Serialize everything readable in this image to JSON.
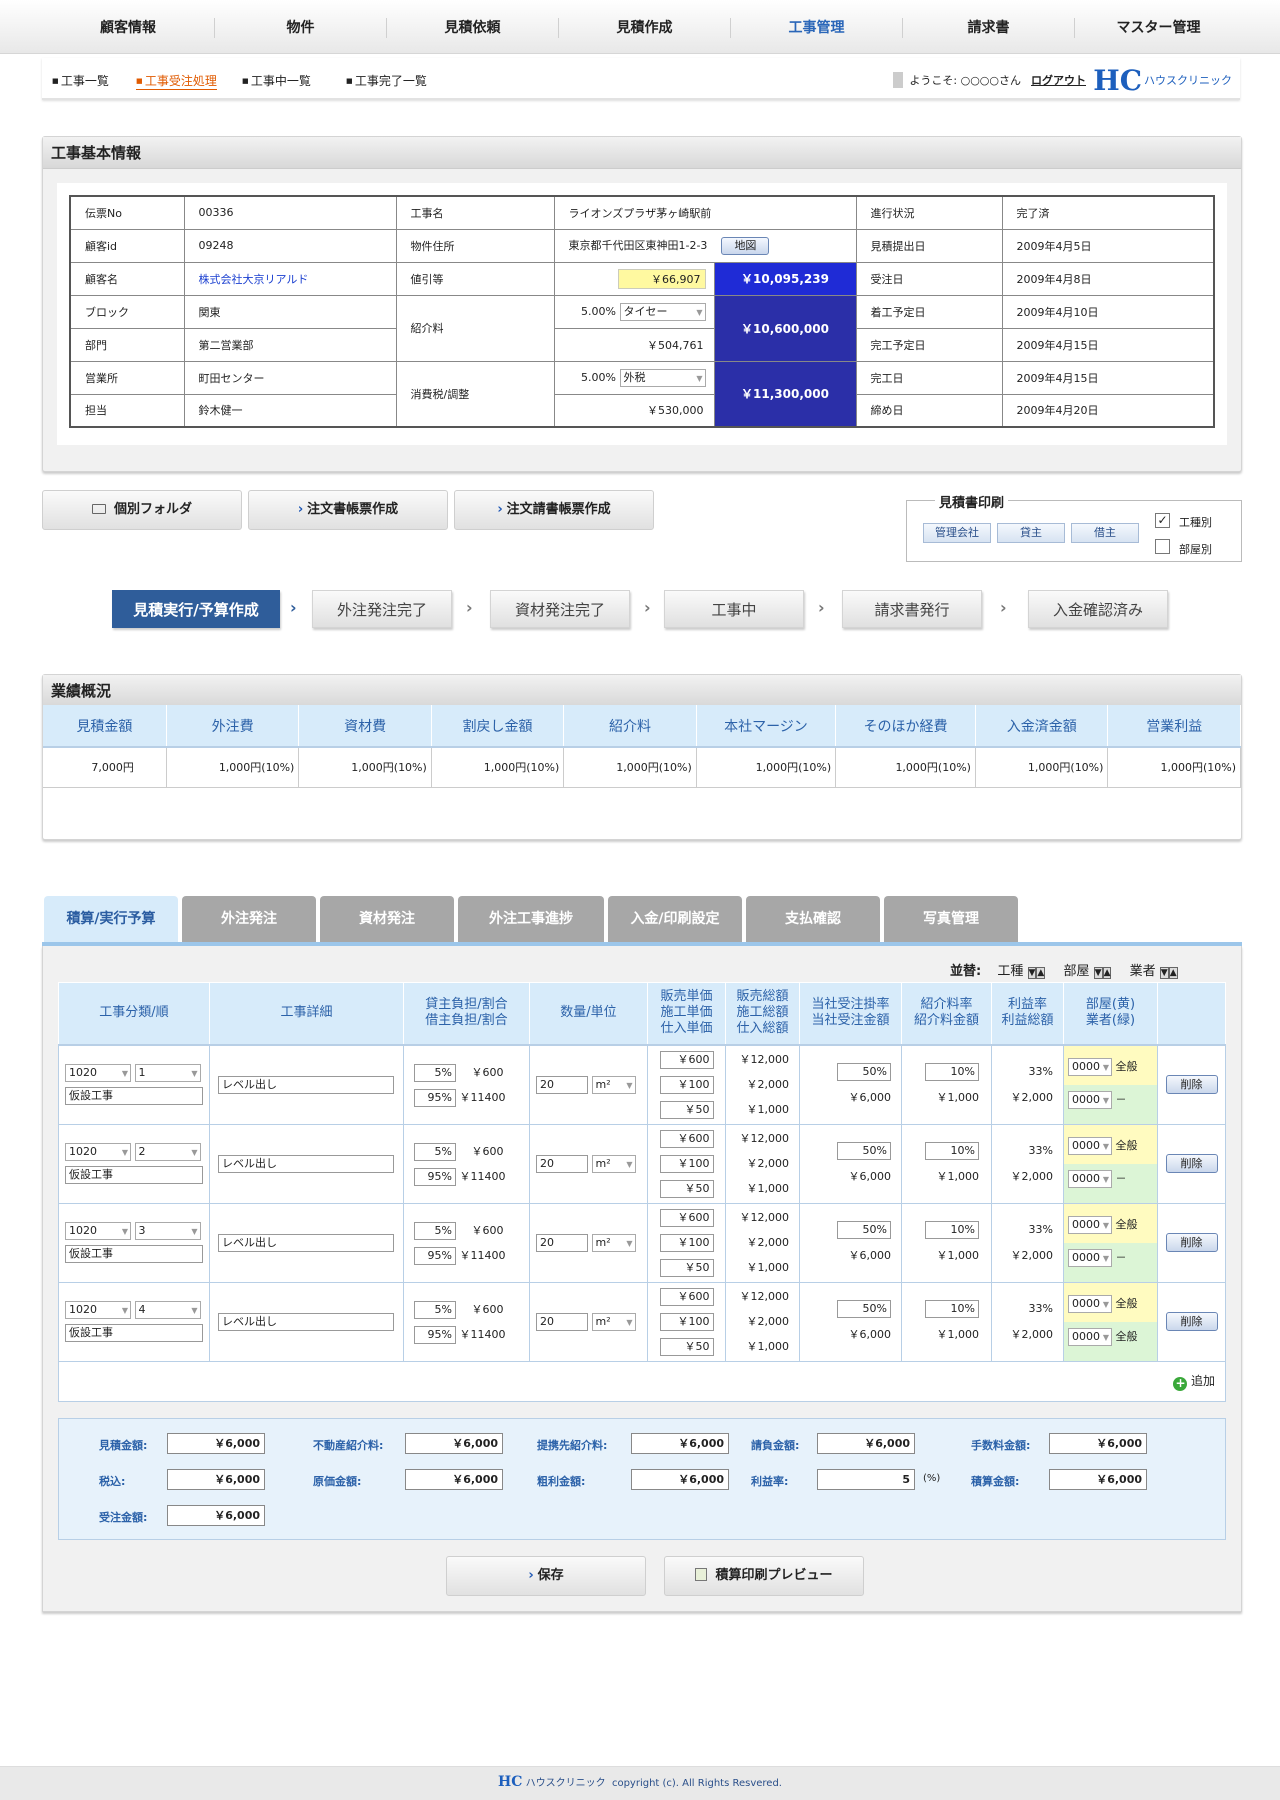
{
  "nav": [
    "顧客情報",
    "物件",
    "見積依頼",
    "見積作成",
    "工事管理",
    "請求書",
    "マスター管理"
  ],
  "subnav": [
    "工事一覧",
    "工事受注処理",
    "工事中一覧",
    "工事完了一覧"
  ],
  "header": {
    "welcome": "ようこそ: ○○○○さん",
    "logout": "ログアウト",
    "logo_mark": "HC",
    "logo_text": "ハウスクリニック"
  },
  "basic": {
    "title": "工事基本情報",
    "denpyo_label": "伝票No",
    "denpyo": "00336",
    "kokyaku_id_label": "顧客id",
    "kokyaku_id": "09248",
    "kokyaku_name_label": "顧客名",
    "kokyaku_name": "株式会社大京リアルド",
    "block_label": "ブロック",
    "block": "関東",
    "bumon_label": "部門",
    "bumon": "第二営業部",
    "eigyosho_label": "営業所",
    "eigyosho": "町田センター",
    "tanto_label": "担当",
    "tanto": "鈴木健一",
    "koji_label": "工事名",
    "koji": "ライオンズプラザ茅ヶ崎駅前",
    "address_label": "物件住所",
    "address": "東京都千代田区東神田1-2-3",
    "map_button": "地図",
    "nebiki_label": "値引等",
    "nebiki": "￥66,907",
    "total1": "￥10,095,239",
    "shokai_label": "紹介料",
    "shokai_rate": "5.00%",
    "shokai_sel": "タイセー",
    "shokai_amount": "￥504,761",
    "total2": "￥10,600,000",
    "tax_label": "消費税/調整",
    "tax_rate": "5.00%",
    "tax_sel": "外税",
    "tax_amount": "￥530,000",
    "total3": "￥11,300,000",
    "status_label": "進行状況",
    "status": "完了済",
    "mitsumori_label": "見積提出日",
    "mitsumori": "2009年4月5日",
    "juchu_label": "受注日",
    "juchu": "2009年4月8日",
    "chakko_label": "着工予定日",
    "chakko": "2009年4月10日",
    "kanryo_yotei_label": "完工予定日",
    "kanryo_yotei": "2009年4月15日",
    "kanko_label": "完工日",
    "kanko": "2009年4月15日",
    "shime_label": "締め日",
    "shime": "2009年4月20日"
  },
  "actions": {
    "folder": "個別フォルダ",
    "order_doc": "注文書帳票作成",
    "order_accept_doc": "注文請書帳票作成"
  },
  "print": {
    "title": "見積書印刷",
    "btn1": "管理会社",
    "btn2": "貸主",
    "btn3": "借主",
    "chk1": "工種別",
    "chk2": "部屋別",
    "chk1_checked": "✓"
  },
  "workflow": [
    "見積実行/予算作成",
    "外注発注完了",
    "資材発注完了",
    "工事中",
    "請求書発行",
    "入金確認済み"
  ],
  "summary": {
    "title": "業績概況",
    "headers": [
      "見積金額",
      "外注費",
      "資材費",
      "割戻し金額",
      "紹介料",
      "本社マージン",
      "そのほか経費",
      "入金済金額",
      "営業利益"
    ],
    "values": [
      "7,000円",
      "1,000円(10%)",
      "1,000円(10%)",
      "1,000円(10%)",
      "1,000円(10%)",
      "1,000円(10%)",
      "1,000円(10%)",
      "1,000円(10%)",
      "1,000円(10%)"
    ]
  },
  "tabs": [
    "積算/実行予算",
    "外注発注",
    "資材発注",
    "外注工事進捗",
    "入金/印刷設定",
    "支払確認",
    "写真管理"
  ],
  "sort": {
    "label": "並替:",
    "k1": "工種",
    "k2": "部屋",
    "k3": "業者"
  },
  "detail": {
    "headers": {
      "h1": "工事分類/順",
      "h2": "工事詳細",
      "h3a": "貸主負担/割合",
      "h3b": "借主負担/割合",
      "h4": "数量/単位",
      "h5a": "販売単価",
      "h5b": "施工単価",
      "h5c": "仕入単価",
      "h6a": "販売総額",
      "h6b": "施工総額",
      "h6c": "仕入総額",
      "h7a": "当社受注掛率",
      "h7b": "当社受注金額",
      "h8a": "紹介料率",
      "h8b": "紹介料金額",
      "h9a": "利益率",
      "h9b": "利益総額",
      "h10a": "部屋(黄)",
      "h10b": "業者(緑)"
    },
    "rows": [
      {
        "code": "1020",
        "order": "1",
        "kind": "仮設工事",
        "detail": "レベル出し",
        "p1": "5%",
        "a1": "￥600",
        "p2": "95%",
        "a2": "￥11400",
        "qty": "20",
        "unit": "m²",
        "u1": "￥600",
        "u2": "￥100",
        "u3": "￥50",
        "t1": "￥12,000",
        "t2": "￥2,000",
        "t3": "￥1,000",
        "rate": "50%",
        "ramt": "￥6,000",
        "srate": "10%",
        "samt": "￥1,000",
        "prate": "33%",
        "pamt": "￥2,000",
        "room": "0000",
        "room_name": "全般",
        "vendor": "0000",
        "vendor_name": "－",
        "del": "削除"
      },
      {
        "code": "1020",
        "order": "2",
        "kind": "仮設工事",
        "detail": "レベル出し",
        "p1": "5%",
        "a1": "￥600",
        "p2": "95%",
        "a2": "￥11400",
        "qty": "20",
        "unit": "m²",
        "u1": "￥600",
        "u2": "￥100",
        "u3": "￥50",
        "t1": "￥12,000",
        "t2": "￥2,000",
        "t3": "￥1,000",
        "rate": "50%",
        "ramt": "￥6,000",
        "srate": "10%",
        "samt": "￥1,000",
        "prate": "33%",
        "pamt": "￥2,000",
        "room": "0000",
        "room_name": "全般",
        "vendor": "0000",
        "vendor_name": "－",
        "del": "削除"
      },
      {
        "code": "1020",
        "order": "3",
        "kind": "仮設工事",
        "detail": "レベル出し",
        "p1": "5%",
        "a1": "￥600",
        "p2": "95%",
        "a2": "￥11400",
        "qty": "20",
        "unit": "m²",
        "u1": "￥600",
        "u2": "￥100",
        "u3": "￥50",
        "t1": "￥12,000",
        "t2": "￥2,000",
        "t3": "￥1,000",
        "rate": "50%",
        "ramt": "￥6,000",
        "srate": "10%",
        "samt": "￥1,000",
        "prate": "33%",
        "pamt": "￥2,000",
        "room": "0000",
        "room_name": "全般",
        "vendor": "0000",
        "vendor_name": "－",
        "del": "削除"
      },
      {
        "code": "1020",
        "order": "4",
        "kind": "仮設工事",
        "detail": "レベル出し",
        "p1": "5%",
        "a1": "￥600",
        "p2": "95%",
        "a2": "￥11400",
        "qty": "20",
        "unit": "m²",
        "u1": "￥600",
        "u2": "￥100",
        "u3": "￥50",
        "t1": "￥12,000",
        "t2": "￥2,000",
        "t3": "￥1,000",
        "rate": "50%",
        "ramt": "￥6,000",
        "srate": "10%",
        "samt": "￥1,000",
        "prate": "33%",
        "pamt": "￥2,000",
        "room": "0000",
        "room_name": "全般",
        "vendor": "0000",
        "vendor_name": "全般",
        "del": "削除"
      }
    ],
    "add": "追加"
  },
  "totals": {
    "mitsumori_label": "見積金額:",
    "mitsumori": "￥6,000",
    "fudosan_label": "不動産紹介料:",
    "fudosan": "￥6,000",
    "teikei_label": "提携先紹介料:",
    "teikei": "￥6,000",
    "ukeoi_label": "請負金額:",
    "ukeoi": "￥6,000",
    "tesuryo_label": "手数料金額:",
    "tesuryo": "￥6,000",
    "zeikomi_label": "税込:",
    "zeikomi": "￥6,000",
    "genka_label": "原価金額:",
    "genka": "￥6,000",
    "arari_label": "粗利金額:",
    "arari": "￥6,000",
    "rieki_label": "利益率:",
    "rieki": "5",
    "rieki_unit": "(%)",
    "sekisan_label": "積算金額:",
    "sekisan": "￥6,000",
    "juchu_label": "受注金額:",
    "juchu": "￥6,000"
  },
  "bottom": {
    "save": "保存",
    "preview": "積算印刷プレビュー"
  },
  "footer": {
    "mark": "HC",
    "brand": "ハウスクリニック",
    "copy": "copyright (c). All Rights Resvered."
  },
  "colors": {
    "accent": "#2a66b8",
    "highlight_yellow": "#fff9a0",
    "total_blue": "#1f2bd6",
    "total_navy": "#2b2fa8",
    "header_blue": "#d7ebfa",
    "active_orange": "#e05a00",
    "room_yellow": "#fffbc0",
    "vendor_green": "#dcf5d6"
  }
}
